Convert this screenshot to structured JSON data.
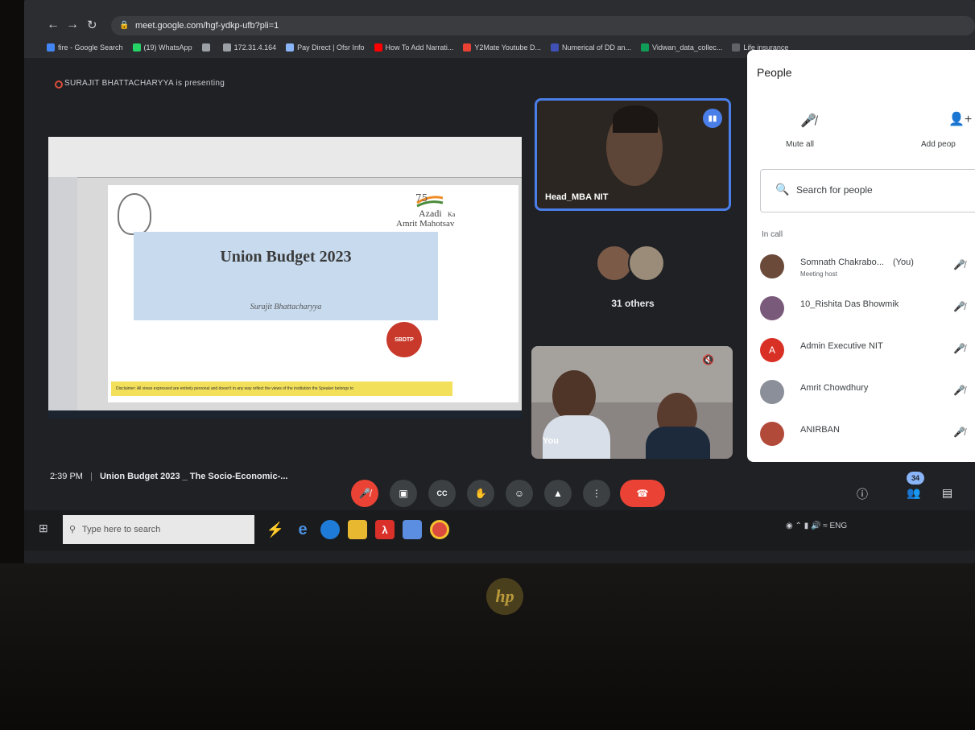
{
  "browser": {
    "url": "meet.google.com/hgf-ydkp-ufb?pli=1",
    "bookmarks": [
      {
        "label": "fire - Google Search",
        "icon": "google-icon",
        "color": "#4285f4"
      },
      {
        "label": "(19) WhatsApp",
        "icon": "whatsapp-icon",
        "color": "#25d366"
      },
      {
        "label": "",
        "icon": "globe-icon",
        "color": "#9aa0a6"
      },
      {
        "label": "172.31.4.164",
        "icon": "globe-icon",
        "color": "#9aa0a6"
      },
      {
        "label": "Pay Direct | Ofsr Info",
        "icon": "search-icon",
        "color": "#8ab4f8"
      },
      {
        "label": "How To Add Narrati...",
        "icon": "youtube-icon",
        "color": "#ff0000"
      },
      {
        "label": "Y2Mate Youtube D...",
        "icon": "y2mate-icon",
        "color": "#e94235"
      },
      {
        "label": "Numerical of DD an...",
        "icon": "slides-icon",
        "color": "#3f51b5"
      },
      {
        "label": "Vidwan_data_collec...",
        "icon": "drive-icon",
        "color": "#0f9d58"
      },
      {
        "label": "Life insurance",
        "icon": "bookmark-icon",
        "color": "#5f6368"
      }
    ]
  },
  "meet": {
    "presenting_text": "SURAJIT BHATTACHARYYA is presenting",
    "slide": {
      "title": "Union Budget 2023",
      "author": "Surajit Bhattacharyya",
      "logo_text_1": "Azadi",
      "logo_text_2": "Ka",
      "logo_text_3": "Amrit Mahotsav",
      "seal_text": "SBDTP",
      "disclaimer": "Disclaimer: All views expressed are entirely personal and doesn't in any way reflect the views of the institution the Speaker belongs to"
    },
    "tiles": {
      "head_name": "Head_MBA NIT",
      "others_label": "31 others",
      "you_label": "You"
    },
    "bottom": {
      "time": "2:39 PM",
      "separator": "|",
      "meeting_title": "Union Budget 2023 _ The Socio-Economic-...",
      "people_count": "34"
    }
  },
  "people_panel": {
    "title": "People",
    "mute_all": "Mute all",
    "add_people": "Add peop",
    "search_placeholder": "Search for people",
    "in_call": "In call",
    "participants": [
      {
        "name": "Somnath Chakrabo...",
        "tag": "(You)",
        "sub": "Meeting host",
        "avatar": "",
        "color": "#6b4a3a"
      },
      {
        "name": "10_Rishita Das Bhowmik",
        "tag": "",
        "sub": "",
        "avatar": "",
        "color": "#7a5a7a"
      },
      {
        "name": "Admin Executive NIT",
        "tag": "",
        "sub": "",
        "avatar": "A",
        "color": "#d93025"
      },
      {
        "name": "Amrit Chowdhury",
        "tag": "",
        "sub": "",
        "avatar": "",
        "color": "#8a8f99"
      },
      {
        "name": "ANIRBAN",
        "tag": "",
        "sub": "",
        "avatar": "",
        "color": "#b24a3a"
      }
    ]
  },
  "taskbar": {
    "search_placeholder": "Type here to search",
    "tray_text": "ENG"
  },
  "device": {
    "brand": "hp"
  }
}
